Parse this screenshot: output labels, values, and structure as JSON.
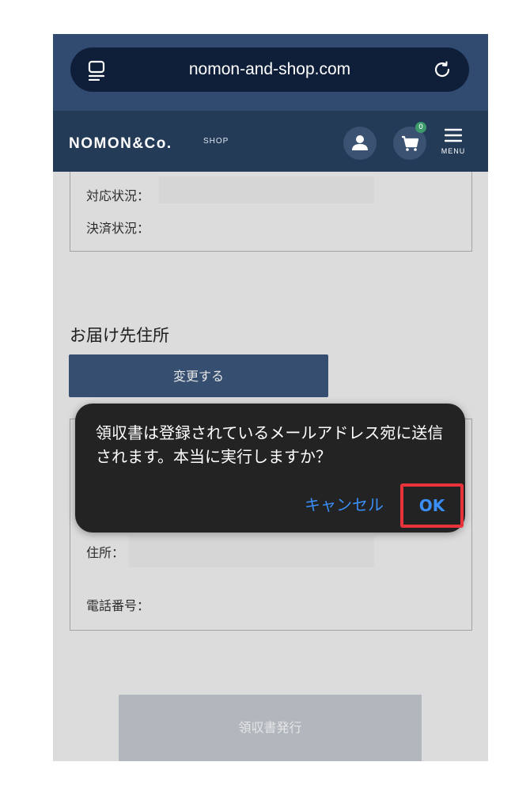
{
  "browser": {
    "url": "nomon-and-shop.com",
    "reader_icon": "reader-mode-icon",
    "reload_icon": "reload-icon"
  },
  "header": {
    "logo": "NOMON&Co.",
    "logo_sub": "SHOP",
    "cart_count": "0",
    "menu_label": "MENU",
    "icons": [
      "user-icon",
      "cart-icon",
      "hamburger-menu-icon"
    ]
  },
  "order_status": {
    "response_label": "対応状況：",
    "payment_label": "決済状況："
  },
  "shipping": {
    "title": "お届け先住所",
    "change_button": "変更する",
    "address_label": "住所：",
    "phone_label": "電話番号："
  },
  "receipt_button": "領収書発行",
  "dialog": {
    "message": "領収書は登録されているメールアドレス宛に送信されます。本当に実行しますか？",
    "cancel": "キャンセル",
    "ok": "OK"
  },
  "colors": {
    "browser_bar": "#304a70",
    "site_header": "#243b58",
    "button_primary": "#3d597e",
    "dialog_bg": "#232323",
    "dialog_action": "#3a8ef6",
    "highlight": "#e8333a"
  }
}
